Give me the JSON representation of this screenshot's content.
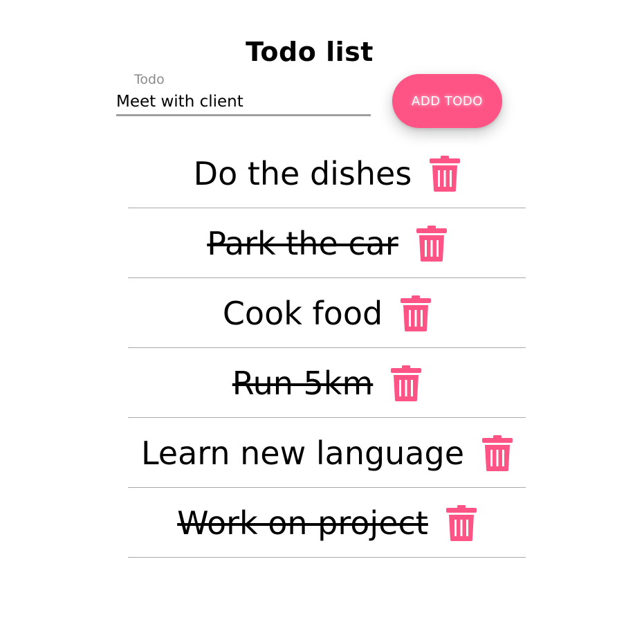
{
  "header": {
    "title": "Todo list"
  },
  "form": {
    "label": "Todo",
    "value": "Meet with client",
    "button_label": "ADD TODO"
  },
  "colors": {
    "accent": "#fe5385",
    "divider": "#a9a9a9",
    "input_underline": "#9e9e9e"
  },
  "todos": [
    {
      "text": "Do the dishes",
      "completed": false,
      "icon": "trash-icon"
    },
    {
      "text": "Park the car",
      "completed": true,
      "icon": "trash-icon"
    },
    {
      "text": "Cook food",
      "completed": false,
      "icon": "trash-icon"
    },
    {
      "text": "Run 5km",
      "completed": true,
      "icon": "trash-icon"
    },
    {
      "text": "Learn new language",
      "completed": false,
      "icon": "trash-icon"
    },
    {
      "text": "Work on project",
      "completed": true,
      "icon": "trash-icon"
    }
  ]
}
